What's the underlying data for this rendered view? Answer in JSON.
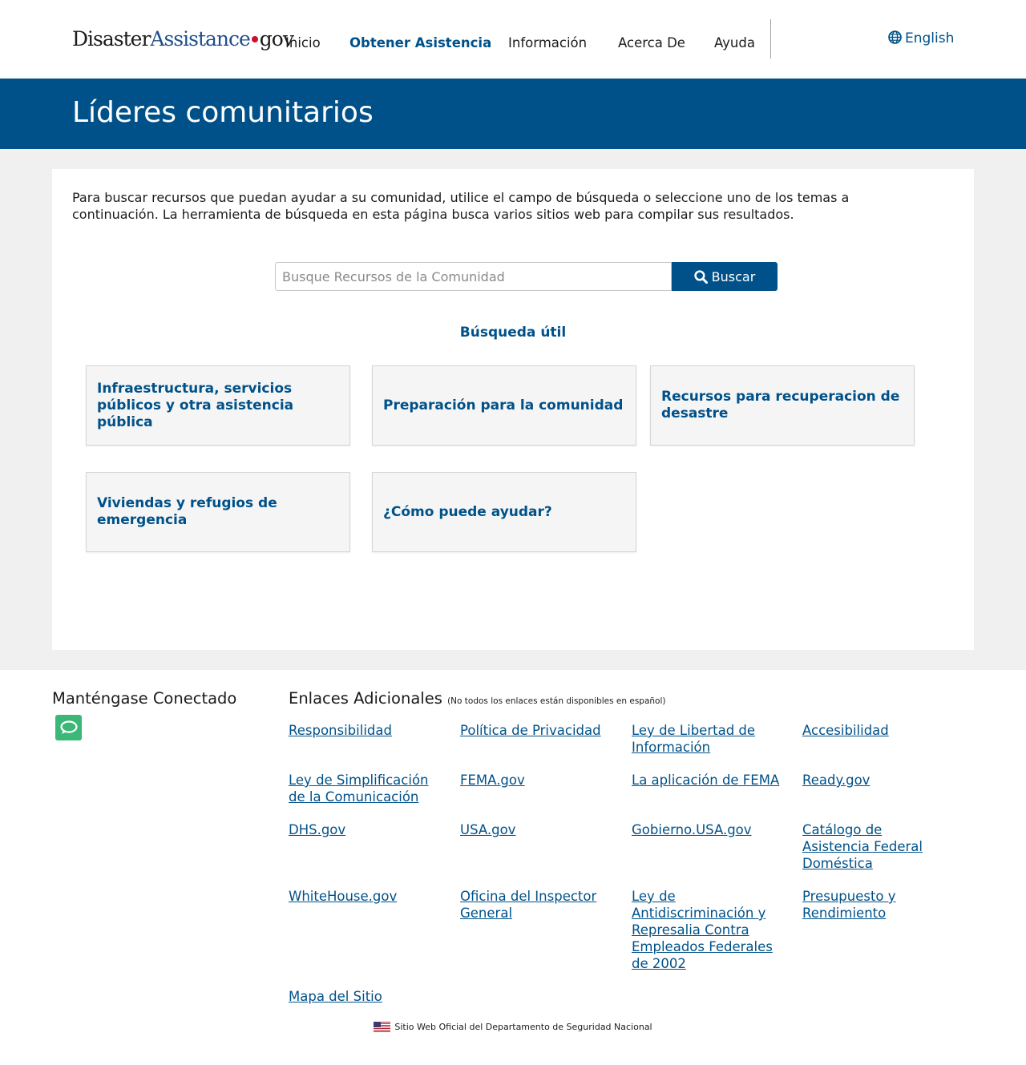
{
  "header": {
    "logo": {
      "part1": "Disaster",
      "part2": "Assistance",
      "part3": "gov"
    },
    "nav": [
      {
        "label": "Inicio"
      },
      {
        "label": "Obtener Asistencia"
      },
      {
        "label": "Información"
      },
      {
        "label": "Acerca De"
      },
      {
        "label": "Ayuda"
      }
    ],
    "language_label": "English"
  },
  "banner": {
    "title": "Líderes comunitarios"
  },
  "main": {
    "intro": "Para buscar recursos que puedan ayudar a su comunidad, utilice el campo de búsqueda o seleccione uno de los temas a continuación. La herramienta de búsqueda en esta página busca varios sitios web para compilar sus resultados.",
    "search": {
      "placeholder": "Busque Recursos de la Comunidad",
      "value": "",
      "button_label": "Buscar"
    },
    "useful_heading": "Búsqueda útil",
    "topics": [
      {
        "label": "Infraestructura, servicios públicos y otra asistencia pública"
      },
      {
        "label": "Preparación para la comunidad"
      },
      {
        "label": "Recursos para recuperacion de desastre"
      },
      {
        "label": "Viviendas y refugios de emergencia"
      },
      {
        "label": "¿Cómo puede ayudar?"
      }
    ]
  },
  "footer": {
    "connected_heading": "Manténgase Conectado",
    "links_heading": "Enlaces Adicionales",
    "links_note": "(No todos los enlaces están disponibles en español)",
    "links": [
      {
        "label": "Responsibilidad"
      },
      {
        "label": "Política de Privacidad"
      },
      {
        "label": "Ley de Libertad de Información"
      },
      {
        "label": "Accesibilidad"
      },
      {
        "label": "Ley de Simplificación de la Comunicación"
      },
      {
        "label": "FEMA.gov"
      },
      {
        "label": "La aplicación de FEMA"
      },
      {
        "label": "Ready.gov"
      },
      {
        "label": "DHS.gov"
      },
      {
        "label": "USA.gov"
      },
      {
        "label": "Gobierno.USA.gov"
      },
      {
        "label": "Catálogo de Asistencia Federal Doméstica"
      },
      {
        "label": "WhiteHouse.gov"
      },
      {
        "label": "Oficina del Inspector General"
      },
      {
        "label": "Ley de Antidiscriminación y Represalia Contra Empleados Federales de 2002"
      },
      {
        "label": "Presupuesto y Rendimiento"
      },
      {
        "label": "Mapa del Sitio"
      }
    ],
    "official_text": "Sitio Web Oficial del Departamento de Seguridad Nacional"
  },
  "colors": {
    "primary": "#005189",
    "background_grey": "#f0f0f0",
    "chat_green": "#3bb878",
    "logo_dot": "#c8102e"
  },
  "icons": {
    "language": "globe-icon",
    "search": "search-icon",
    "connect": "chat-icon",
    "flag": "us-flag-icon"
  }
}
